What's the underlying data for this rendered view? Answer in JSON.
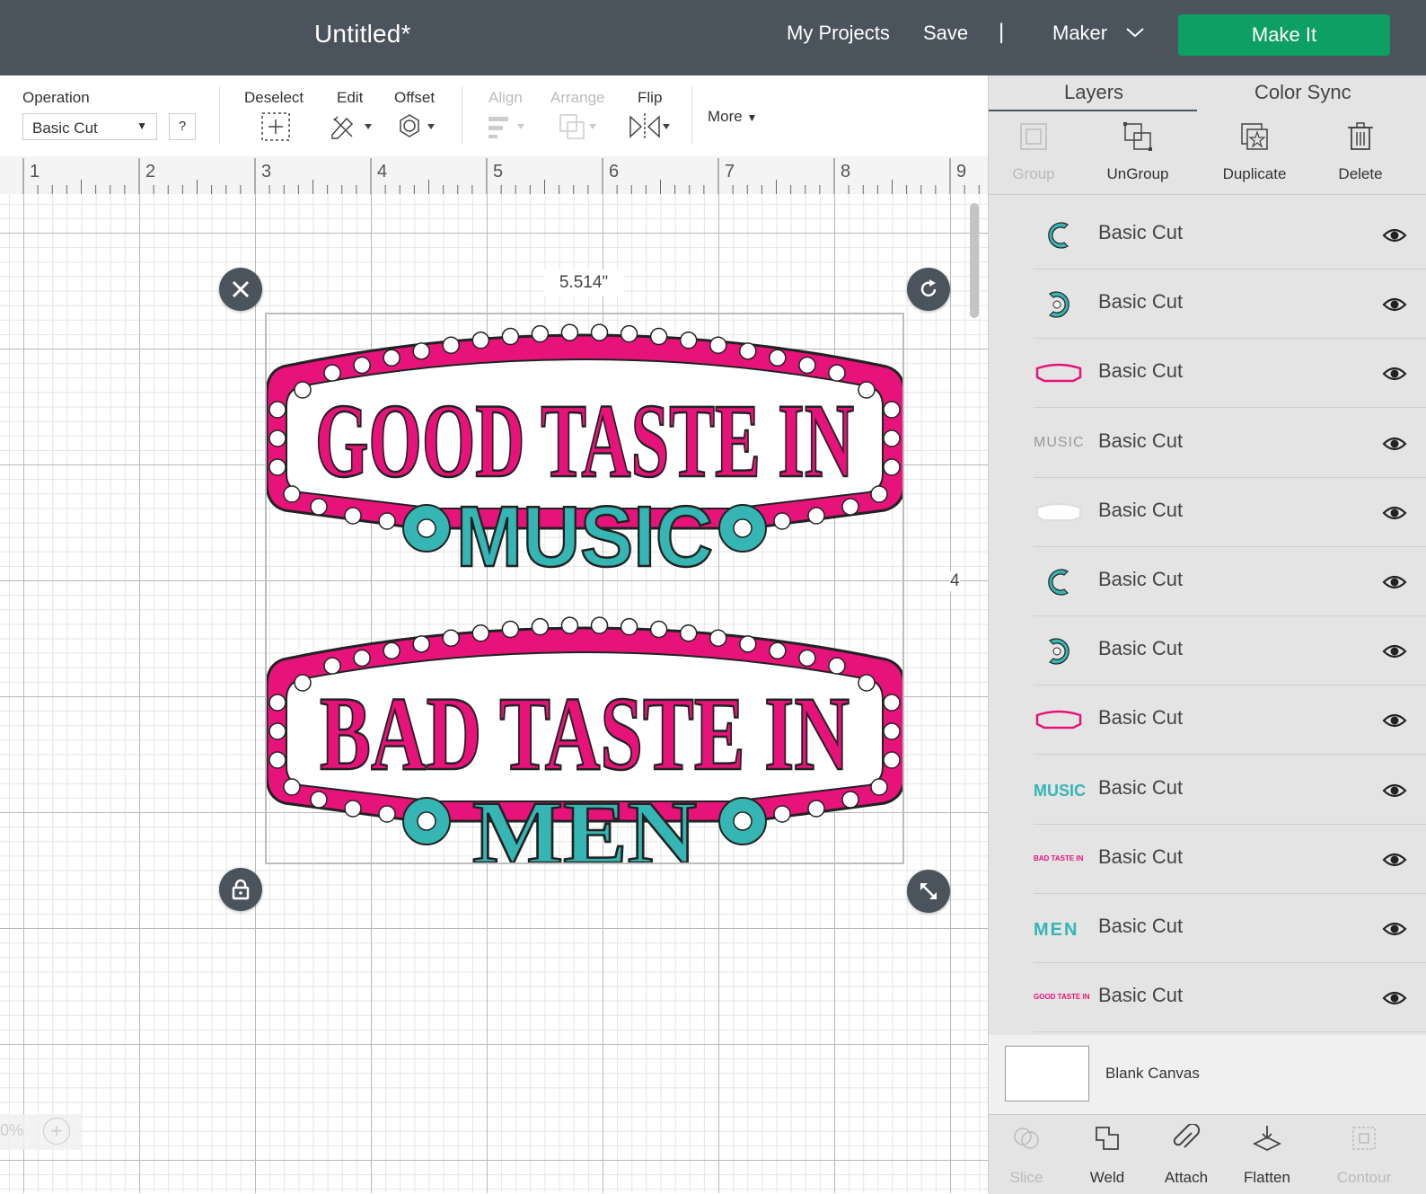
{
  "topbar": {
    "title": "Untitled*",
    "my_projects": "My Projects",
    "save": "Save",
    "separator": "|",
    "machine": "Maker",
    "make_it": "Make It"
  },
  "toolbar": {
    "operation_label": "Operation",
    "operation_value": "Basic Cut",
    "help": "?",
    "deselect": "Deselect",
    "edit": "Edit",
    "offset": "Offset",
    "align": "Align",
    "arrange": "Arrange",
    "flip": "Flip",
    "more": "More"
  },
  "ruler": [
    "1",
    "2",
    "3",
    "4",
    "5",
    "6",
    "7",
    "8",
    "9"
  ],
  "canvas": {
    "width_label": "5.514\"",
    "height_label": "4",
    "zoom": "0%",
    "zoom_plus": "+",
    "design": {
      "top_text": "GOOD TASTE IN",
      "top_sub": "MUSIC",
      "bottom_text": "BAD TASTE IN",
      "bottom_sub": "MEN"
    }
  },
  "panel": {
    "tabs": [
      "Layers",
      "Color Sync"
    ],
    "actions": [
      "Group",
      "UnGroup",
      "Duplicate",
      "Delete"
    ],
    "layers": [
      {
        "name": "Basic Cut",
        "thumb": "c-left"
      },
      {
        "name": "Basic Cut",
        "thumb": "c-right"
      },
      {
        "name": "Basic Cut",
        "thumb": "arc-pink"
      },
      {
        "name": "Basic Cut",
        "thumb": "music-outline",
        "thumb_text": "MUSIC"
      },
      {
        "name": "Basic Cut",
        "thumb": "arc-white"
      },
      {
        "name": "Basic Cut",
        "thumb": "c-left"
      },
      {
        "name": "Basic Cut",
        "thumb": "c-right"
      },
      {
        "name": "Basic Cut",
        "thumb": "arc-pink"
      },
      {
        "name": "Basic Cut",
        "thumb": "music-teal",
        "thumb_text": "MUSIC"
      },
      {
        "name": "Basic Cut",
        "thumb": "bad-taste",
        "thumb_text": "BAD TASTE IN"
      },
      {
        "name": "Basic Cut",
        "thumb": "men-teal",
        "thumb_text": "MEN"
      },
      {
        "name": "Basic Cut",
        "thumb": "good-taste",
        "thumb_text": "GOOD TASTE IN"
      }
    ],
    "blank_canvas": "Blank Canvas",
    "bottom_actions": [
      "Slice",
      "Weld",
      "Attach",
      "Flatten",
      "Contour"
    ]
  },
  "colors": {
    "topbar": "#4b535c",
    "make_it": "#0d9f63",
    "pink": "#e8127b",
    "teal": "#35b5b4"
  }
}
